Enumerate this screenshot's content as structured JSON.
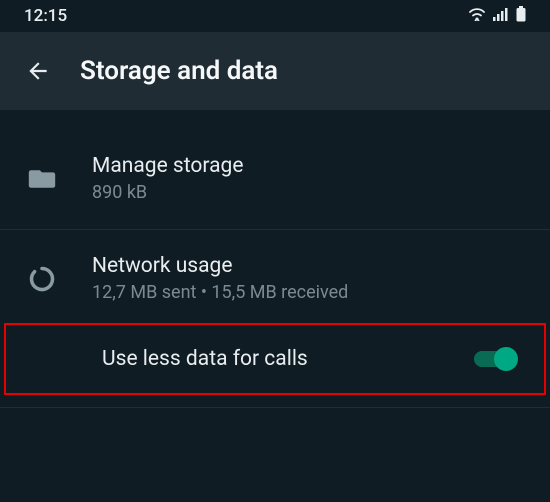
{
  "status_bar": {
    "time": "12:15"
  },
  "header": {
    "title": "Storage and data"
  },
  "manage_storage": {
    "title": "Manage storage",
    "subtitle": "890 kB"
  },
  "network_usage": {
    "title": "Network usage",
    "subtitle": "12,7 MB sent • 15,5 MB received"
  },
  "use_less_data": {
    "title": "Use less data for calls",
    "enabled": true
  },
  "colors": {
    "accent": "#00a884",
    "header_bg": "#1f2c34",
    "bg": "#0f1c23"
  }
}
